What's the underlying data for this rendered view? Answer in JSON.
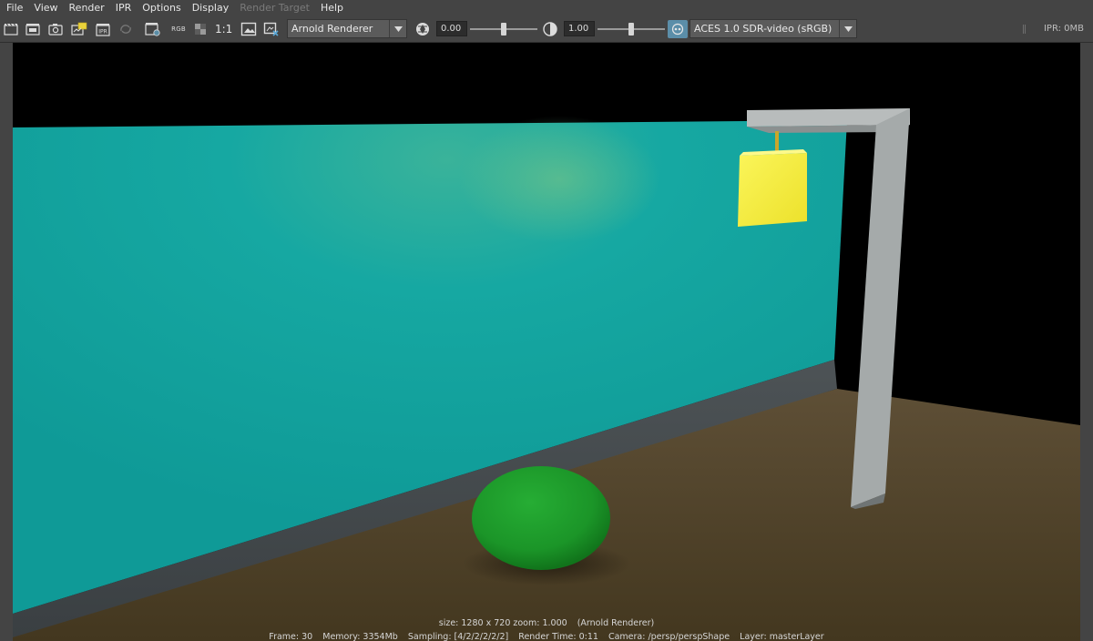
{
  "menu": {
    "items": [
      {
        "label": "File",
        "disabled": false
      },
      {
        "label": "View",
        "disabled": false
      },
      {
        "label": "Render",
        "disabled": false
      },
      {
        "label": "IPR",
        "disabled": false
      },
      {
        "label": "Options",
        "disabled": false
      },
      {
        "label": "Display",
        "disabled": false
      },
      {
        "label": "Render Target",
        "disabled": true
      },
      {
        "label": "Help",
        "disabled": false
      }
    ]
  },
  "toolbar": {
    "rgb_label": "RGB",
    "zoom_label": "1:1",
    "renderer": "Arnold Renderer",
    "exposure_value": "0.00",
    "exposure_level": 0.5,
    "gamma_value": "1.00",
    "gamma_level": 0.5,
    "view_transform": "ACES 1.0 SDR-video (sRGB)",
    "ipr_memory": "IPR: 0MB",
    "icons": [
      "render-frame-icon",
      "ipr-render-icon",
      "snapshot-icon",
      "render-region-icon",
      "ipr-toggle-icon",
      "refresh-disabled-icon",
      "render-settings-icon",
      "rgb-channel-icon",
      "display-alpha-icon",
      "real-size-icon",
      "keep-image-icon",
      "remove-image-icon",
      "exposure-aperture-icon",
      "gamma-icon",
      "color-management-icon"
    ]
  },
  "scene": {
    "wall_color": "#14a59f",
    "floor_color": "#54452f",
    "sphere_color": "#1c9a2a",
    "lamp_color": "#f5ee3c",
    "post_color": "#9ea3a3"
  },
  "render_info": {
    "line1": "size: 1280 x 720 zoom: 1.000",
    "renderer_tag": "(Arnold Renderer)",
    "frame": "Frame: 30",
    "memory": "Memory: 3354Mb",
    "sampling": "Sampling: [4/2/2/2/2/2]",
    "render_time": "Render Time: 0:11",
    "camera": "Camera: /persp/perspShape",
    "layer": "Layer: masterLayer"
  }
}
